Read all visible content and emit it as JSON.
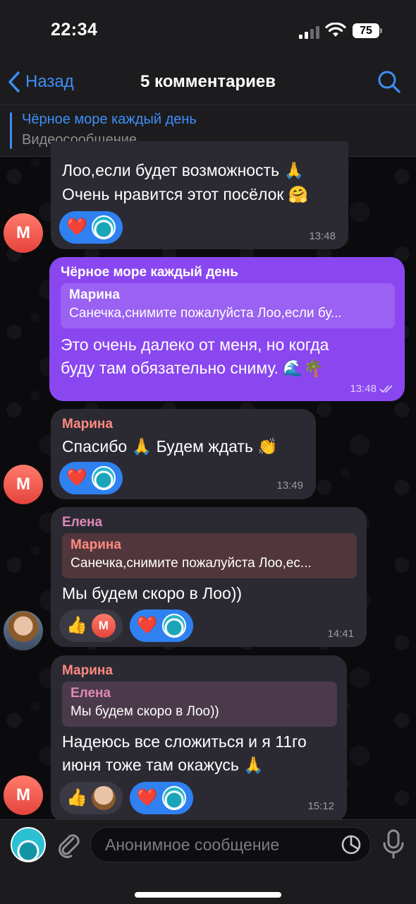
{
  "status": {
    "time": "22:34",
    "battery": "75"
  },
  "header": {
    "back_label": "Назад",
    "title": "5 комментариев"
  },
  "pinned": {
    "title": "Чёрное море каждый день",
    "subtitle": "Видеосообщение"
  },
  "messages": [
    {
      "lines": [
        "Лоо,если будет возможность 🙏",
        "Очень нравится этот посёлок 🤗"
      ],
      "time": "13:48",
      "avatar_letter": "М"
    },
    {
      "sender": "Чёрное море каждый день",
      "reply_name": "Марина",
      "reply_text": "Санечка,снимите пожалуйста Лоо,если бу...",
      "lines": [
        "Это очень далеко от меня, но когда",
        "буду там обязательно сниму. 🌊🌴"
      ],
      "time": "13:48"
    },
    {
      "sender": "Марина",
      "lines": [
        "Спасибо 🙏 Будем ждать 👏"
      ],
      "time": "13:49",
      "avatar_letter": "М"
    },
    {
      "sender": "Елена",
      "reply_name": "Марина",
      "reply_text": "Санечка,снимите пожалуйста Лоо,ес...",
      "lines": [
        "Мы будем скоро в Лоо))"
      ],
      "time": "14:41",
      "reaction_avatar_letter": "М"
    },
    {
      "sender": "Марина",
      "reply_name": "Елена",
      "reply_text": "Мы будем скоро в Лоо))",
      "lines": [
        "Надеюсь все сложиться и я 11го",
        "июня тоже там окажусь 🙏"
      ],
      "time": "15:12",
      "avatar_letter": "М"
    }
  ],
  "reactions": {
    "heart": "❤️",
    "thumbs_up": "👍"
  },
  "composer": {
    "placeholder": "Анонимное сообщение"
  },
  "colors": {
    "accent": "#3e8ef7",
    "own_bubble": "#8a47f0",
    "other_bubble": "#2b2a33",
    "marina_name": "#ff8a80",
    "elena_name": "#e089b8",
    "reaction_pill": "#2f81f1"
  }
}
